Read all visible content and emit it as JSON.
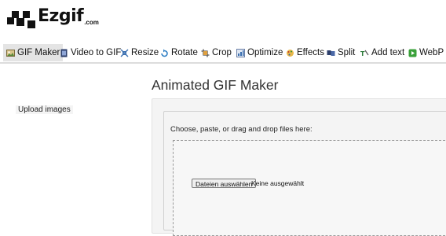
{
  "logo": {
    "name": "Ezgif",
    "suffix": ".com"
  },
  "nav": [
    {
      "label": "GIF Maker",
      "icon": "gif-maker-icon",
      "active": true
    },
    {
      "label": "Video to GIF",
      "icon": "film-icon"
    },
    {
      "label": "Resize",
      "icon": "resize-icon"
    },
    {
      "label": "Rotate",
      "icon": "rotate-icon"
    },
    {
      "label": "Crop",
      "icon": "crop-icon"
    },
    {
      "label": "Optimize",
      "icon": "optimize-icon"
    },
    {
      "label": "Effects",
      "icon": "effects-icon"
    },
    {
      "label": "Split",
      "icon": "split-icon"
    },
    {
      "label": "Add text",
      "icon": "add-text-icon"
    },
    {
      "label": "WebP",
      "icon": "webp-icon"
    }
  ],
  "main": {
    "title": "Animated GIF Maker",
    "upload": {
      "legend": "Upload images",
      "hint": "Choose, paste, or drag and drop files here:",
      "file_button": "Dateien auswählen",
      "file_status": "Keine ausgewählt"
    }
  },
  "colors": {
    "nav_active_bg": "#e4e4e4",
    "panel_bg": "#f4f4f4",
    "text": "#222222"
  }
}
